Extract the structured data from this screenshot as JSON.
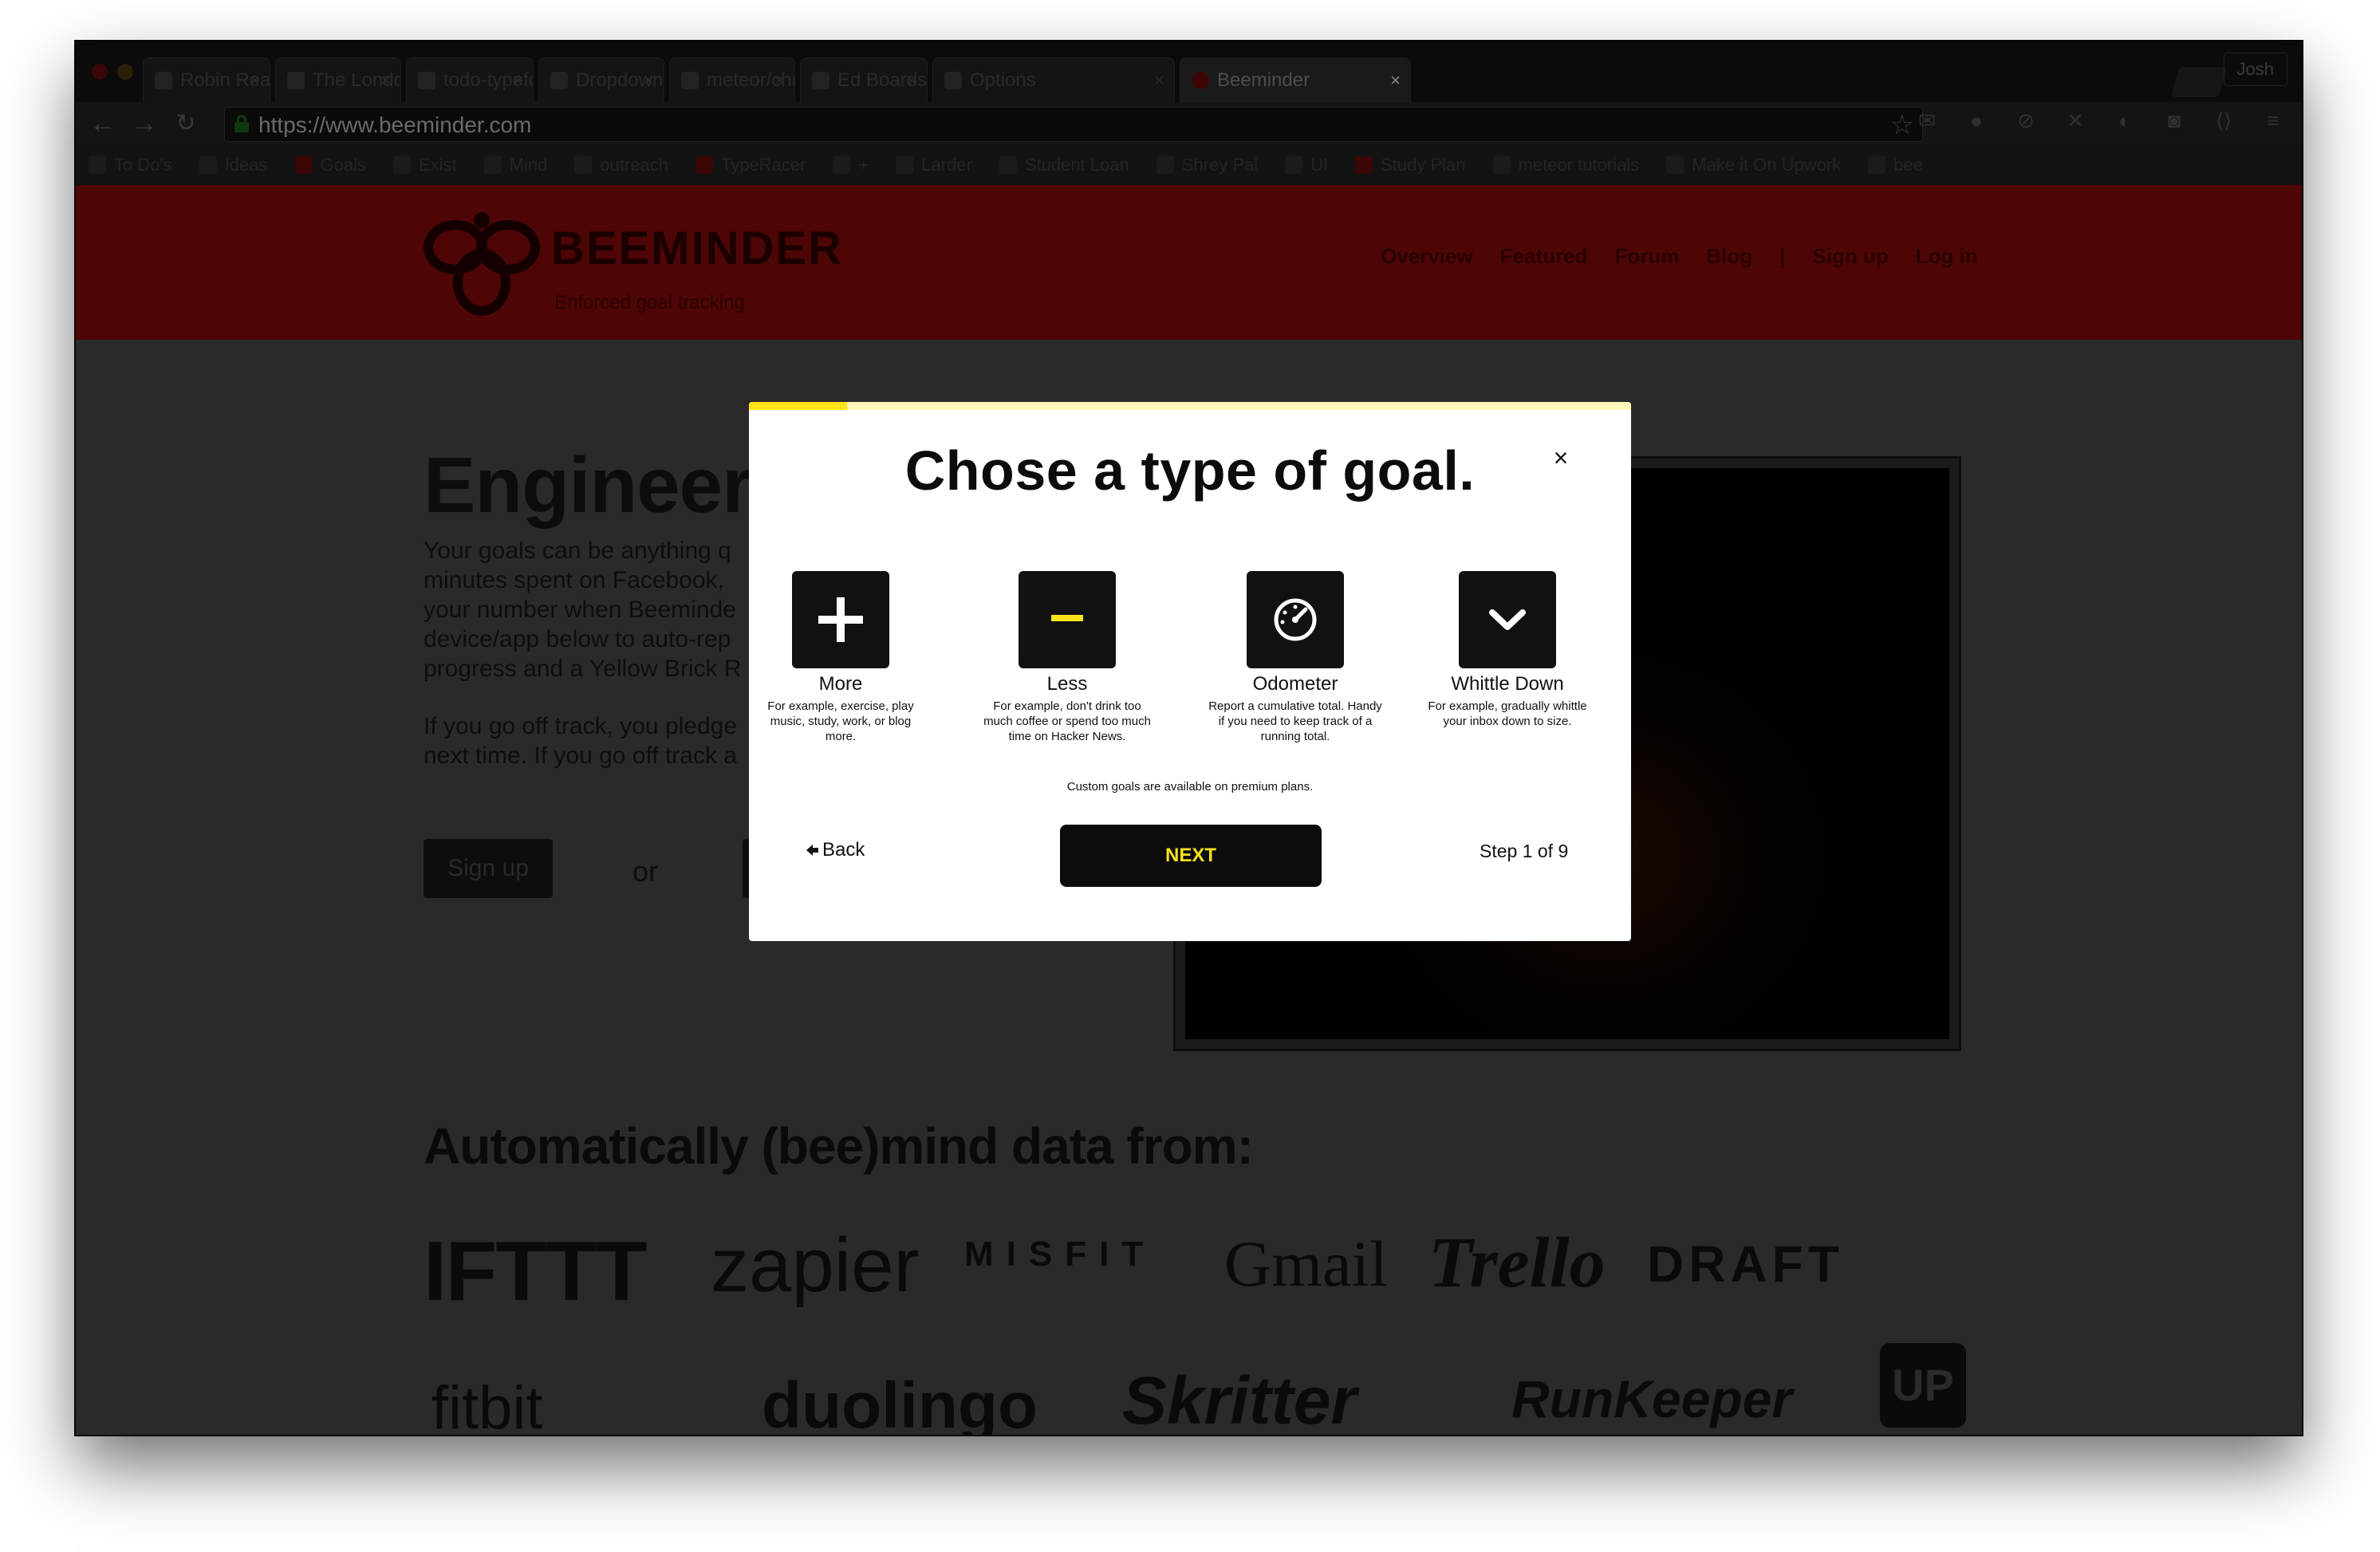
{
  "browser": {
    "tabs": [
      {
        "title": "Robin Reading in da",
        "active": false
      },
      {
        "title": "The London Undergr",
        "active": false
      },
      {
        "title": "todo-typeform-as",
        "active": false
      },
      {
        "title": "Dropdown",
        "active": false
      },
      {
        "title": "meteor/chromatic",
        "active": false
      },
      {
        "title": "Ed Boards - black a",
        "active": false
      },
      {
        "title": "Options",
        "active": false
      },
      {
        "title": "Beeminder",
        "active": true
      }
    ],
    "profile_name": "Josh",
    "url": "https://www.beeminder.com",
    "bookmarks": [
      "To Do's",
      "Ideas",
      "Goals",
      "Exist",
      "Mind",
      "outreach",
      "TypeRacer",
      "+",
      "Larder",
      "Student Loan",
      "Shrey Pal",
      "UI",
      "Study Plan",
      "meteor tutorials",
      "Make it On Upwork",
      "bee"
    ]
  },
  "site": {
    "logo_word": "BEEMINDER",
    "tagline": "Enforced goal tracking",
    "nav": [
      "Overview",
      "Featured",
      "Forum",
      "Blog",
      "|",
      "Sign up",
      "Log in"
    ],
    "hero_title": "Engineer Yourself",
    "hero_p1": "Your goals can be anything q minutes spent on Facebook, your number when Beeminde device/app below to auto-rep progress and a Yellow Brick R",
    "hero_p2": "If you go off track, you pledge next time. If you go off track a",
    "signup_label": "Sign up",
    "or_label": "or",
    "auto_title": "Automatically (bee)mind data from:",
    "brands": [
      "IFTTT",
      "zapier",
      "MISFIT",
      "Gmail",
      "Trello",
      "DRAFT",
      "fitbit",
      "duolingo",
      "Skritter",
      "RunKeeper",
      "UP"
    ]
  },
  "modal": {
    "title": "Chose a type of goal.",
    "close_label": "×",
    "progress_fraction": 0.111,
    "options": [
      {
        "label": "More",
        "icon": "plus-icon",
        "description": "For example, exercise, play music, study, work, or blog more."
      },
      {
        "label": "Less",
        "icon": "minus-icon",
        "description": "For example, don't drink too much coffee or spend too much time on Hacker News."
      },
      {
        "label": "Odometer",
        "icon": "speedometer-icon",
        "description": "Report a cumulative total. Handy if you need to keep track of a running total."
      },
      {
        "label": "Whittle Down",
        "icon": "chevron-down-icon",
        "description": "For example, gradually whittle your inbox down to size."
      }
    ],
    "custom_note": "Custom goals are available on premium plans.",
    "back_label": "Back",
    "next_label": "NEXT",
    "step_text": "Step 1 of 9"
  },
  "colors": {
    "accent_yellow": "#fee31a",
    "brand_red": "#4d0505",
    "modal_bg": "#ffffff",
    "overlay": "#2a2a2a"
  }
}
